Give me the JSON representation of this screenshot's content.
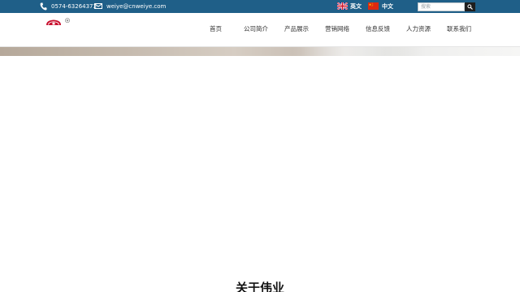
{
  "topbar": {
    "phone_icon": "phone-icon",
    "phone": "0574-63264373",
    "email_icon": "mail-icon",
    "email": "weiye@cnweiye.com",
    "lang_en": "英文",
    "lang_cn": "中文",
    "search_placeholder": "搜索",
    "search_icon": "search-icon",
    "bg_color": "#1f5f88"
  },
  "header": {
    "logo": "company-logo",
    "nav": [
      {
        "label": "首页"
      },
      {
        "label": "公司简介"
      },
      {
        "label": "产品展示"
      },
      {
        "label": "营销网络"
      },
      {
        "label": "信息反馈"
      },
      {
        "label": "人力资源"
      },
      {
        "label": "联系我们"
      }
    ]
  },
  "main": {
    "section_title": "关于伟业"
  }
}
